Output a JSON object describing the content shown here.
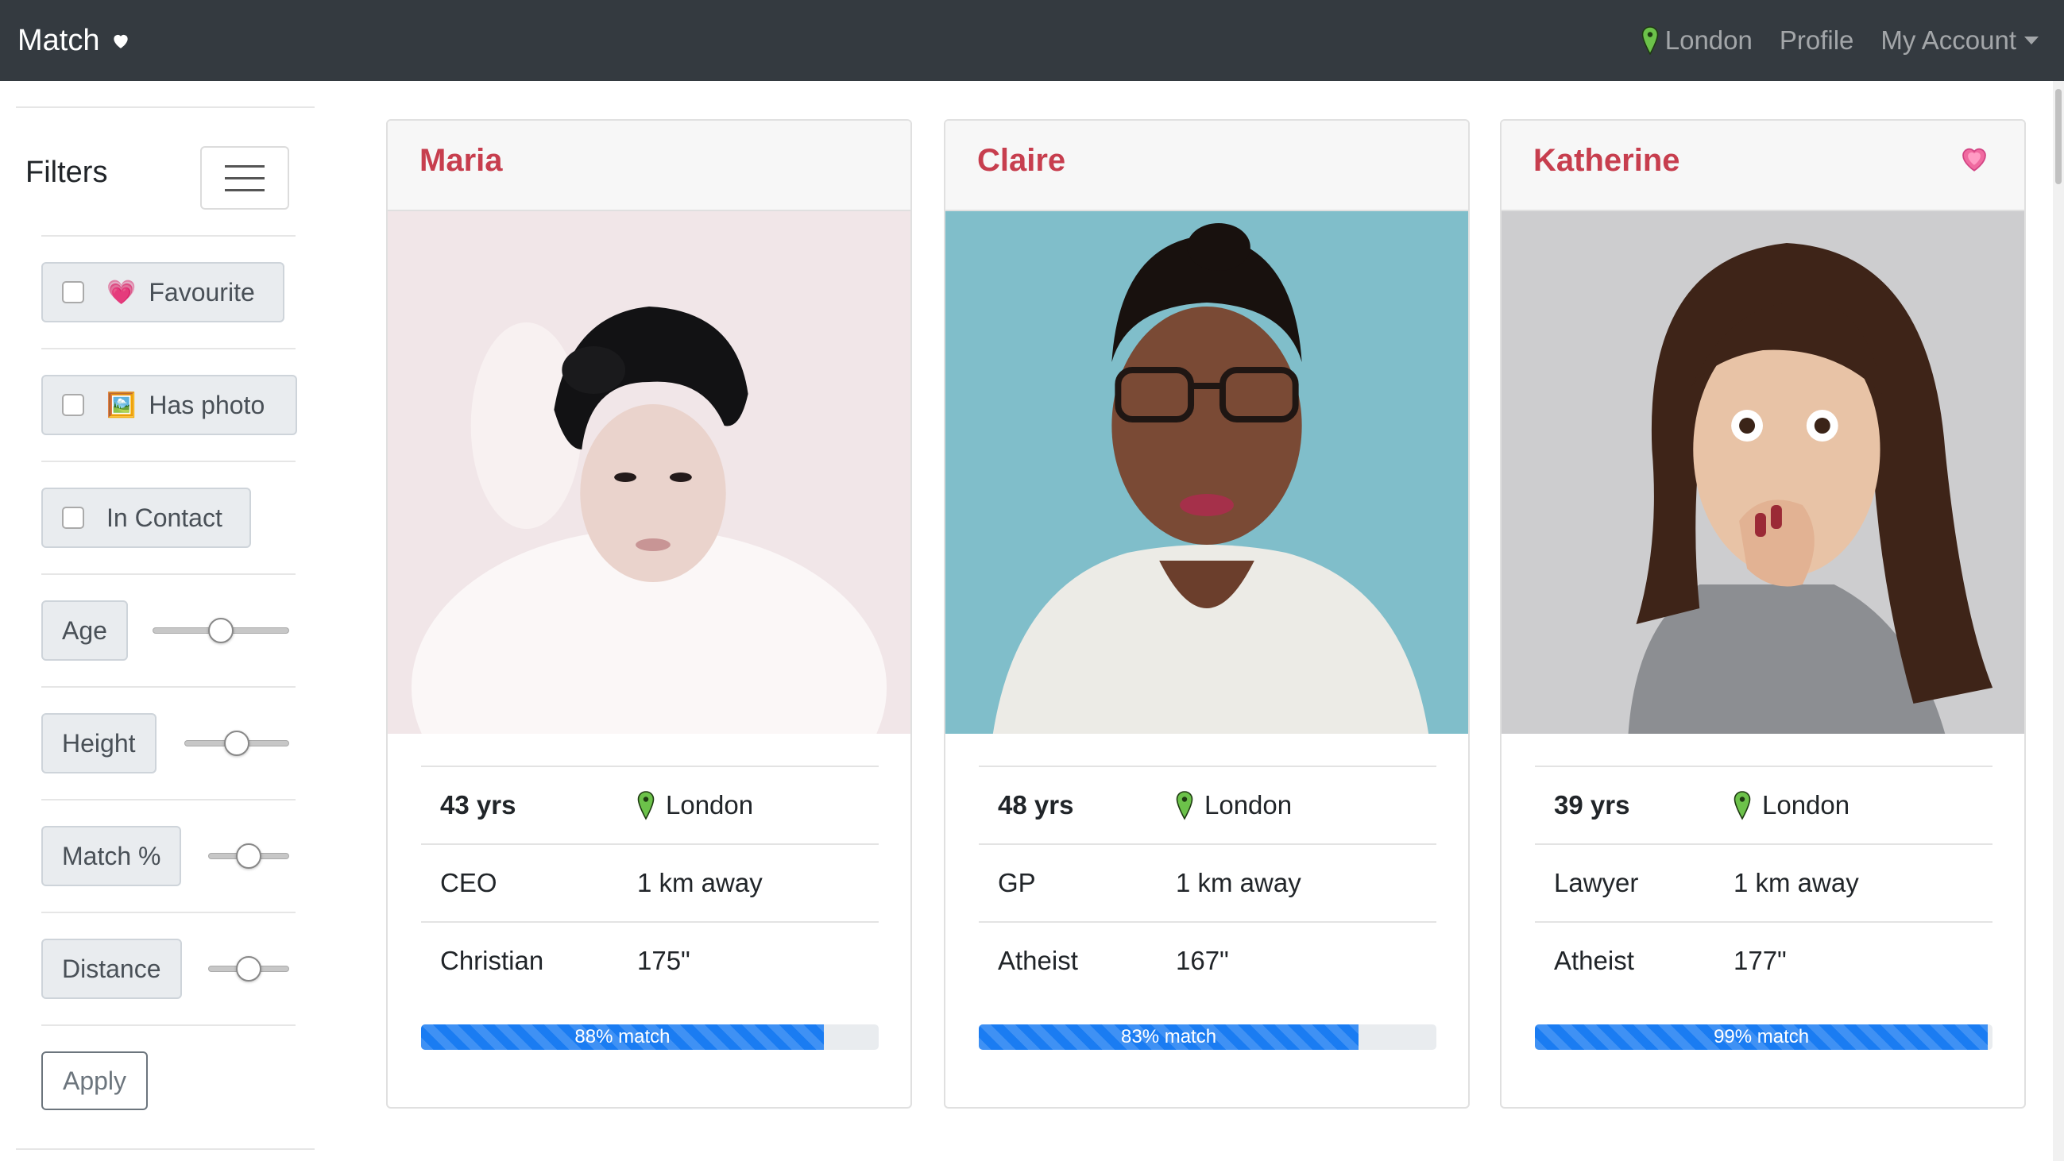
{
  "navbar": {
    "brand": "Match",
    "location": "London",
    "profile": "Profile",
    "account": "My Account"
  },
  "sidebar": {
    "title": "Filters",
    "favourite": "Favourite",
    "has_photo": "Has photo",
    "in_contact": "In Contact",
    "age": "Age",
    "height": "Height",
    "match": "Match %",
    "distance": "Distance",
    "apply": "Apply",
    "age_value": 0.5,
    "height_value": 0.5,
    "match_value": 0.5,
    "distance_value": 0.5,
    "icons": {
      "favourite": "sparkling-heart-icon",
      "has_photo": "framed-picture-icon"
    }
  },
  "profiles": [
    {
      "name": "Maria",
      "age": "43 yrs",
      "location": "London",
      "job": "CEO",
      "distance": "1 km away",
      "religion": "Christian",
      "height": "175\"",
      "match_label": "88% match",
      "match": 88,
      "favourite": false
    },
    {
      "name": "Claire",
      "age": "48 yrs",
      "location": "London",
      "job": "GP",
      "distance": "1 km away",
      "religion": "Atheist",
      "height": "167\"",
      "match_label": "83% match",
      "match": 83,
      "favourite": false
    },
    {
      "name": "Katherine",
      "age": "39 yrs",
      "location": "London",
      "job": "Lawyer",
      "distance": "1 km away",
      "religion": "Atheist",
      "height": "177\"",
      "match_label": "99% match",
      "match": 99,
      "favourite": true
    }
  ],
  "colors": {
    "navbar": "#343a40",
    "name": "#c73e4e",
    "progress": "#1a7cf2",
    "pin": "#5cb85c"
  }
}
